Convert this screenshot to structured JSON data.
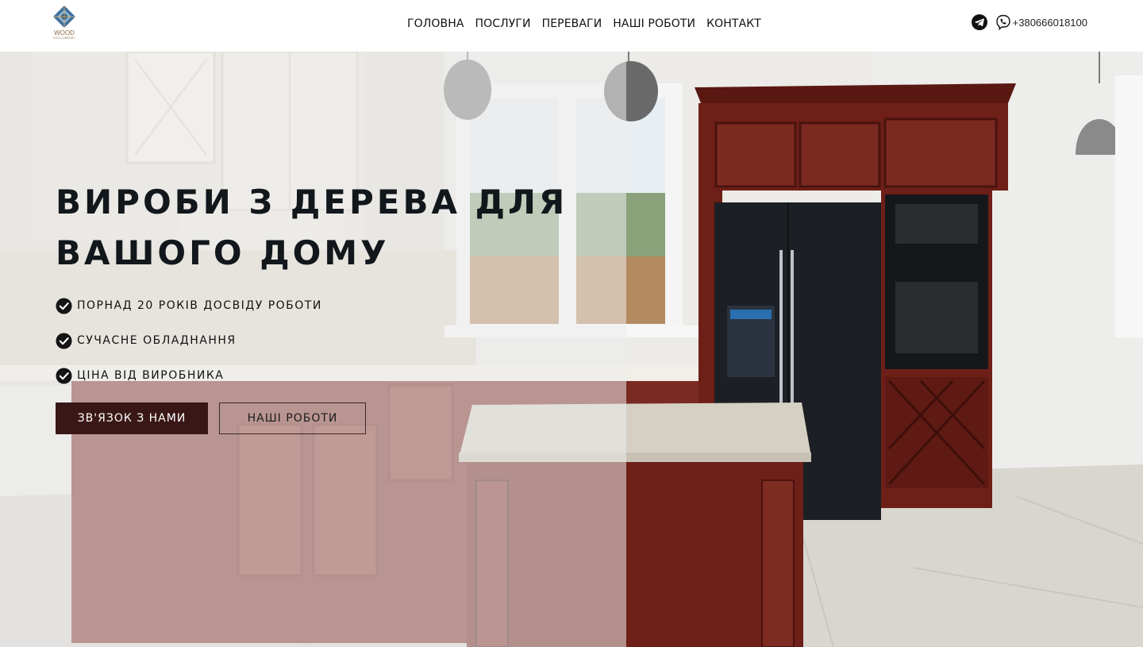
{
  "header": {
    "logo": {
      "word": "WOOD",
      "sub": "ECO COMFORT"
    },
    "nav": [
      {
        "label": "ГОЛОВНА"
      },
      {
        "label": "ПОСЛУГИ"
      },
      {
        "label": "ПЕРЕВАГИ"
      },
      {
        "label": "НАШІ РОБОТИ"
      },
      {
        "label": "КОНТАКТ"
      }
    ],
    "contacts": {
      "telegram_icon": "telegram-icon",
      "viber_icon": "viber-icon",
      "phone": "+380666018100"
    }
  },
  "hero": {
    "title_line1": "ВИРОБИ З ДЕРЕВА ДЛЯ",
    "title_line2": "ВАШОГО ДОМУ",
    "features": [
      {
        "text": "ПОРНАД 20 РОКІВ ДОСВІДУ РОБОТИ",
        "icon": "check-circle-icon"
      },
      {
        "text": "СУЧАСНЕ ОБЛАДНАННЯ",
        "icon": "check-circle-icon"
      },
      {
        "text": "ЦІНА ВІД ВИРОБНИКА",
        "icon": "check-circle-icon"
      }
    ],
    "buttons": {
      "contact": "ЗВ'ЯЗОК З НАМИ",
      "works": "НАШІ РОБОТИ"
    }
  },
  "colors": {
    "primary_button": "#3a1717",
    "wood_cabinet": "#6e1f17",
    "logo_brown": "#8a6b47",
    "logo_blue": "#3f6f9c"
  }
}
